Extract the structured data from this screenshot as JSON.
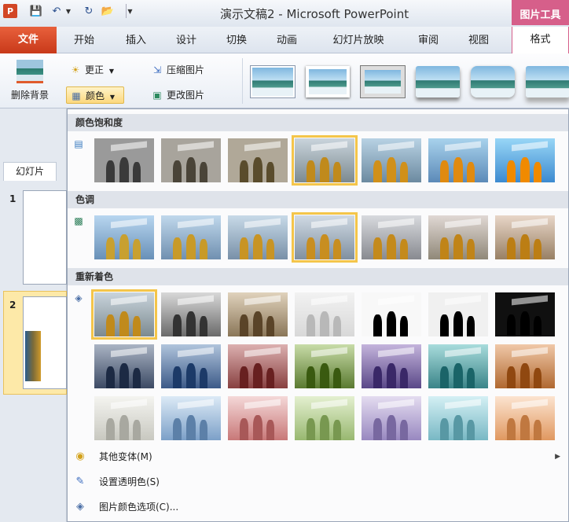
{
  "title_bar": {
    "app_icon": "P",
    "title": "演示文稿2 - Microsoft PowerPoint",
    "context_tab": "图片工具"
  },
  "tabs": [
    "文件",
    "开始",
    "插入",
    "设计",
    "切换",
    "动画",
    "幻灯片放映",
    "审阅",
    "视图",
    "格式"
  ],
  "ribbon": {
    "remove_background": "删除背景",
    "corrections": "更正",
    "color": "颜色",
    "compress": "压缩图片",
    "change_picture": "更改图片"
  },
  "left_pane": {
    "tab": "幻灯片",
    "slides": [
      "1",
      "2"
    ]
  },
  "color_panel": {
    "sections": [
      {
        "title": "颜色饱和度",
        "icon": "saturation-icon",
        "selected": 3
      },
      {
        "title": "色调",
        "icon": "tone-icon",
        "selected": 3
      },
      {
        "title": "重新着色",
        "icon": "recolor-icon",
        "selected": 0
      }
    ],
    "menu": {
      "more_variants": "其他变体(M)",
      "set_transparent": "设置透明色(S)",
      "color_options": "图片颜色选项(C)..."
    }
  },
  "colors": {
    "file_tab": "#d24625",
    "context_tab": "#d65f8a",
    "selection": "#f4c54a"
  }
}
